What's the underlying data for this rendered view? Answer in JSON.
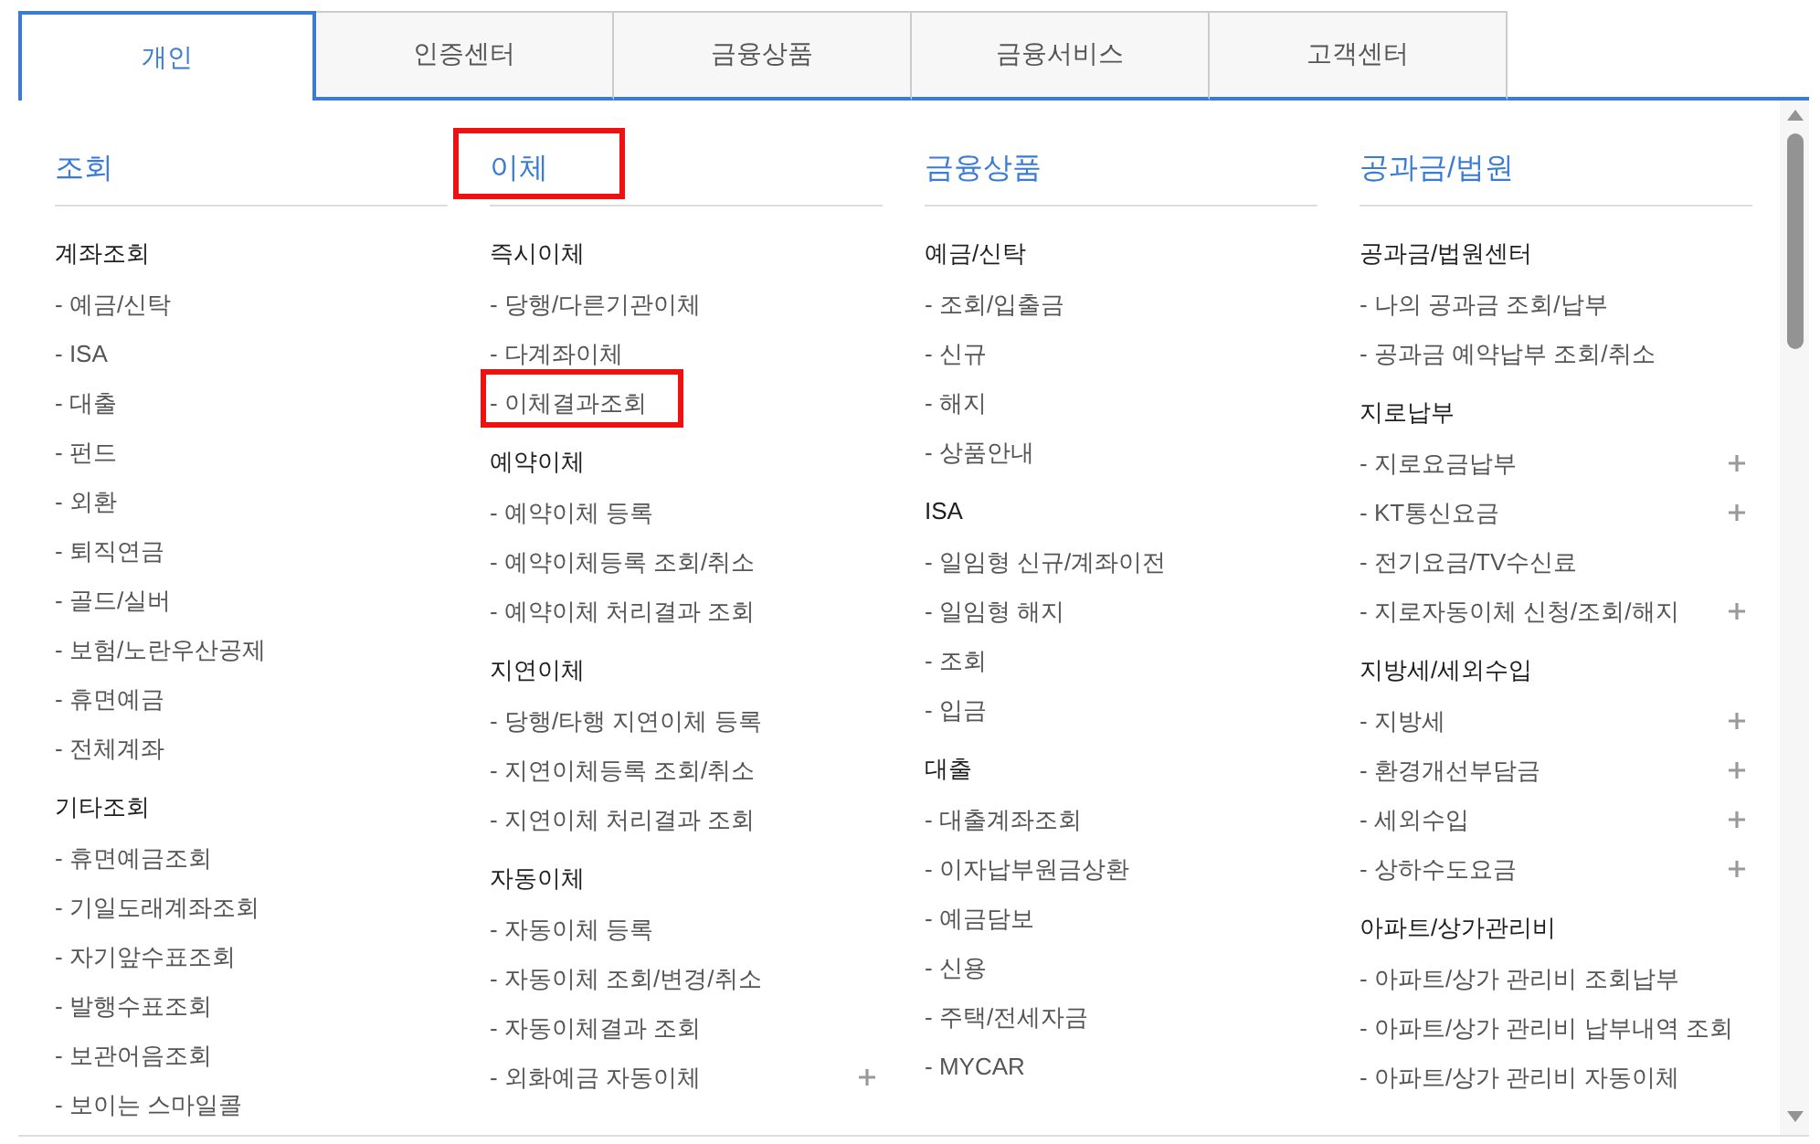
{
  "tabs": [
    {
      "label": "개인",
      "selected": true
    },
    {
      "label": "인증센터",
      "selected": false
    },
    {
      "label": "금융상품",
      "selected": false
    },
    {
      "label": "금융서비스",
      "selected": false
    },
    {
      "label": "고객센터",
      "selected": false
    }
  ],
  "menu": {
    "columns": [
      {
        "title": "조회",
        "highlighted": false,
        "sections": [
          {
            "title": "계좌조회",
            "items": [
              {
                "label": "- 예금/신탁",
                "highlighted": false,
                "expandable": false
              },
              {
                "label": "- ISA",
                "highlighted": false,
                "expandable": false
              },
              {
                "label": "- 대출",
                "highlighted": false,
                "expandable": false
              },
              {
                "label": "- 펀드",
                "highlighted": false,
                "expandable": false
              },
              {
                "label": "- 외환",
                "highlighted": false,
                "expandable": false
              },
              {
                "label": "- 퇴직연금",
                "highlighted": false,
                "expandable": false
              },
              {
                "label": "- 골드/실버",
                "highlighted": false,
                "expandable": false
              },
              {
                "label": "- 보험/노란우산공제",
                "highlighted": false,
                "expandable": false
              },
              {
                "label": "- 휴면예금",
                "highlighted": false,
                "expandable": false
              },
              {
                "label": "- 전체계좌",
                "highlighted": false,
                "expandable": false
              }
            ]
          },
          {
            "title": "기타조회",
            "items": [
              {
                "label": "- 휴면예금조회",
                "highlighted": false,
                "expandable": false
              },
              {
                "label": "- 기일도래계좌조회",
                "highlighted": false,
                "expandable": false
              },
              {
                "label": "- 자기앞수표조회",
                "highlighted": false,
                "expandable": false
              },
              {
                "label": "- 발행수표조회",
                "highlighted": false,
                "expandable": false
              },
              {
                "label": "- 보관어음조회",
                "highlighted": false,
                "expandable": false
              },
              {
                "label": "- 보이는 스마일콜",
                "highlighted": false,
                "expandable": false
              }
            ]
          }
        ]
      },
      {
        "title": "이체",
        "highlighted": true,
        "sections": [
          {
            "title": "즉시이체",
            "items": [
              {
                "label": "- 당행/다른기관이체",
                "highlighted": false,
                "expandable": false
              },
              {
                "label": "- 다계좌이체",
                "highlighted": false,
                "expandable": false
              },
              {
                "label": "- 이체결과조회",
                "highlighted": true,
                "expandable": false
              }
            ]
          },
          {
            "title": "예약이체",
            "items": [
              {
                "label": "- 예약이체 등록",
                "highlighted": false,
                "expandable": false
              },
              {
                "label": "- 예약이체등록 조회/취소",
                "highlighted": false,
                "expandable": false
              },
              {
                "label": "- 예약이체 처리결과 조회",
                "highlighted": false,
                "expandable": false
              }
            ]
          },
          {
            "title": "지연이체",
            "items": [
              {
                "label": "- 당행/타행 지연이체 등록",
                "highlighted": false,
                "expandable": false
              },
              {
                "label": "- 지연이체등록 조회/취소",
                "highlighted": false,
                "expandable": false
              },
              {
                "label": "- 지연이체 처리결과 조회",
                "highlighted": false,
                "expandable": false
              }
            ]
          },
          {
            "title": "자동이체",
            "items": [
              {
                "label": "- 자동이체 등록",
                "highlighted": false,
                "expandable": false
              },
              {
                "label": "- 자동이체 조회/변경/취소",
                "highlighted": false,
                "expandable": false
              },
              {
                "label": "- 자동이체결과 조회",
                "highlighted": false,
                "expandable": false
              },
              {
                "label": "- 외화예금 자동이체",
                "highlighted": false,
                "expandable": true
              }
            ]
          }
        ]
      },
      {
        "title": "금융상품",
        "highlighted": false,
        "sections": [
          {
            "title": "예금/신탁",
            "items": [
              {
                "label": "- 조회/입출금",
                "highlighted": false,
                "expandable": false
              },
              {
                "label": "- 신규",
                "highlighted": false,
                "expandable": false
              },
              {
                "label": "- 해지",
                "highlighted": false,
                "expandable": false
              },
              {
                "label": "- 상품안내",
                "highlighted": false,
                "expandable": false
              }
            ]
          },
          {
            "title": "ISA",
            "items": [
              {
                "label": "- 일임형 신규/계좌이전",
                "highlighted": false,
                "expandable": false
              },
              {
                "label": "- 일임형 해지",
                "highlighted": false,
                "expandable": false
              },
              {
                "label": "- 조회",
                "highlighted": false,
                "expandable": false
              },
              {
                "label": "- 입금",
                "highlighted": false,
                "expandable": false
              }
            ]
          },
          {
            "title": "대출",
            "items": [
              {
                "label": "- 대출계좌조회",
                "highlighted": false,
                "expandable": false
              },
              {
                "label": "- 이자납부원금상환",
                "highlighted": false,
                "expandable": false
              },
              {
                "label": "- 예금담보",
                "highlighted": false,
                "expandable": false
              },
              {
                "label": "- 신용",
                "highlighted": false,
                "expandable": false
              },
              {
                "label": "- 주택/전세자금",
                "highlighted": false,
                "expandable": false
              },
              {
                "label": "- MYCAR",
                "highlighted": false,
                "expandable": false
              }
            ]
          }
        ]
      },
      {
        "title": "공과금/법원",
        "highlighted": false,
        "sections": [
          {
            "title": "공과금/법원센터",
            "items": [
              {
                "label": "- 나의 공과금 조회/납부",
                "highlighted": false,
                "expandable": false
              },
              {
                "label": "- 공과금 예약납부 조회/취소",
                "highlighted": false,
                "expandable": false
              }
            ]
          },
          {
            "title": "지로납부",
            "items": [
              {
                "label": "- 지로요금납부",
                "highlighted": false,
                "expandable": true
              },
              {
                "label": "- KT통신요금",
                "highlighted": false,
                "expandable": true
              },
              {
                "label": "- 전기요금/TV수신료",
                "highlighted": false,
                "expandable": false
              },
              {
                "label": "- 지로자동이체 신청/조회/해지",
                "highlighted": false,
                "expandable": true
              }
            ]
          },
          {
            "title": "지방세/세외수입",
            "items": [
              {
                "label": "- 지방세",
                "highlighted": false,
                "expandable": true
              },
              {
                "label": "- 환경개선부담금",
                "highlighted": false,
                "expandable": true
              },
              {
                "label": "- 세외수입",
                "highlighted": false,
                "expandable": true
              },
              {
                "label": "- 상하수도요금",
                "highlighted": false,
                "expandable": true
              }
            ]
          },
          {
            "title": "아파트/상가관리비",
            "items": [
              {
                "label": "- 아파트/상가 관리비 조회납부",
                "highlighted": false,
                "expandable": false
              },
              {
                "label": "- 아파트/상가 관리비 납부내역 조회",
                "highlighted": false,
                "expandable": false
              },
              {
                "label": "- 아파트/상가 관리비 자동이체",
                "highlighted": false,
                "expandable": false
              }
            ]
          }
        ]
      }
    ]
  }
}
